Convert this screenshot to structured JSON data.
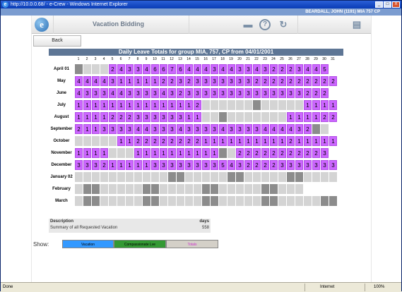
{
  "window": {
    "title": "http://10.0.0.68/ - e-Crew - Windows Internet Explorer",
    "min": "_",
    "max": "□",
    "close": "X"
  },
  "user": {
    "info": "BEARDALL, JOHN (1191) MIA 757 CP"
  },
  "header": {
    "logo_letter": "e",
    "app_title": "Vacation Bidding",
    "icons": [
      "printer-icon",
      "help-icon",
      "exit-icon",
      "notepad-icon"
    ]
  },
  "back_label": "Back",
  "grid": {
    "title": "Daily Leave Totals for group MIA, 757, CP from 04/01/2001",
    "days": [
      "1",
      "2",
      "3",
      "4",
      "5",
      "6",
      "7",
      "8",
      "9",
      "10",
      "11",
      "12",
      "13",
      "14",
      "15",
      "16",
      "17",
      "18",
      "19",
      "20",
      "21",
      "22",
      "23",
      "24",
      "25",
      "26",
      "27",
      "28",
      "29",
      "30",
      "31"
    ],
    "months": [
      {
        "name": "April 01",
        "cells": [
          "d",
          "l",
          "l",
          "l",
          "2",
          "4",
          "3",
          "3",
          "4",
          "6",
          "6",
          "7",
          "6",
          "4",
          "4",
          "4",
          "3",
          "4",
          "4",
          "3",
          "3",
          "4",
          "3",
          "2",
          "2",
          "2",
          "3",
          "4",
          "4",
          "5",
          "x"
        ]
      },
      {
        "name": "May",
        "cells": [
          "4",
          "4",
          "4",
          "4",
          "3",
          "1",
          "1",
          "1",
          "1",
          "1",
          "2",
          "2",
          "3",
          "2",
          "3",
          "3",
          "3",
          "3",
          "3",
          "3",
          "3",
          "2",
          "2",
          "2",
          "2",
          "2",
          "2",
          "2",
          "2",
          "2",
          "2"
        ]
      },
      {
        "name": "June",
        "cells": [
          "4",
          "3",
          "3",
          "3",
          "4",
          "4",
          "3",
          "3",
          "3",
          "3",
          "4",
          "3",
          "2",
          "3",
          "3",
          "3",
          "3",
          "3",
          "3",
          "3",
          "3",
          "3",
          "3",
          "3",
          "3",
          "3",
          "3",
          "2",
          "2",
          "2",
          "w"
        ]
      },
      {
        "name": "July",
        "cells": [
          "1",
          "1",
          "1",
          "1",
          "1",
          "1",
          "1",
          "1",
          "1",
          "1",
          "1",
          "1",
          "1",
          "1",
          "2",
          "l",
          "l",
          "l",
          "l",
          "l",
          "l",
          "d",
          "l",
          "l",
          "l",
          "l",
          "l",
          "1",
          "1",
          "1",
          "1"
        ]
      },
      {
        "name": "August",
        "cells": [
          "1",
          "1",
          "1",
          "1",
          "2",
          "2",
          "2",
          "3",
          "3",
          "3",
          "3",
          "3",
          "3",
          "1",
          "1",
          "l",
          "l",
          "d",
          "l",
          "l",
          "l",
          "l",
          "l",
          "l",
          "l",
          "1",
          "1",
          "1",
          "1",
          "2",
          "2"
        ]
      },
      {
        "name": "September",
        "cells": [
          "2",
          "1",
          "1",
          "3",
          "3",
          "3",
          "3",
          "4",
          "4",
          "3",
          "3",
          "3",
          "4",
          "3",
          "3",
          "3",
          "3",
          "4",
          "3",
          "3",
          "3",
          "3",
          "4",
          "4",
          "4",
          "4",
          "3",
          "2",
          "d",
          "l",
          "w"
        ]
      },
      {
        "name": "October",
        "cells": [
          "l",
          "l",
          "l",
          "l",
          "l",
          "1",
          "1",
          "2",
          "2",
          "2",
          "2",
          "2",
          "2",
          "2",
          "2",
          "1",
          "1",
          "1",
          "1",
          "1",
          "1",
          "1",
          "1",
          "1",
          "1",
          "2",
          "1",
          "1",
          "1",
          "1",
          "1"
        ]
      },
      {
        "name": "November",
        "cells": [
          "1",
          "1",
          "1",
          "1",
          "l",
          "l",
          "l",
          "1",
          "1",
          "1",
          "1",
          "1",
          "1",
          "1",
          "1",
          "1",
          "1",
          "d",
          "l",
          "2",
          "2",
          "2",
          "2",
          "2",
          "2",
          "2",
          "2",
          "2",
          "2",
          "3",
          "w"
        ]
      },
      {
        "name": "December",
        "cells": [
          "3",
          "3",
          "3",
          "2",
          "1",
          "1",
          "1",
          "1",
          "1",
          "3",
          "3",
          "3",
          "3",
          "3",
          "3",
          "3",
          "3",
          "5",
          "4",
          "3",
          "2",
          "2",
          "2",
          "2",
          "3",
          "3",
          "3",
          "3",
          "3",
          "3",
          "3"
        ]
      },
      {
        "name": "January 02",
        "cells": [
          "l",
          "l",
          "l",
          "l",
          "l",
          "l",
          "l",
          "l",
          "l",
          "l",
          "l",
          "d",
          "d",
          "l",
          "l",
          "l",
          "l",
          "l",
          "d",
          "d",
          "l",
          "l",
          "l",
          "l",
          "l",
          "d",
          "d",
          "l",
          "l",
          "l",
          "l"
        ]
      },
      {
        "name": "February",
        "cells": [
          "l",
          "d",
          "d",
          "l",
          "l",
          "l",
          "l",
          "l",
          "d",
          "d",
          "l",
          "l",
          "l",
          "l",
          "l",
          "d",
          "d",
          "l",
          "l",
          "l",
          "l",
          "l",
          "d",
          "d",
          "l",
          "l",
          "l",
          "w",
          "w",
          "w",
          "w"
        ]
      },
      {
        "name": "March",
        "cells": [
          "l",
          "d",
          "d",
          "l",
          "l",
          "l",
          "l",
          "l",
          "d",
          "d",
          "l",
          "l",
          "l",
          "l",
          "l",
          "d",
          "d",
          "l",
          "l",
          "l",
          "l",
          "l",
          "d",
          "d",
          "l",
          "l",
          "l",
          "l",
          "l",
          "d",
          "d"
        ]
      }
    ]
  },
  "summary": {
    "col_desc": "Description",
    "col_days": "days",
    "row_desc": "Summary of all Requested Vacation",
    "row_days": "558"
  },
  "legend": {
    "show_label": "Show:",
    "vacation": "Vacation",
    "compassionate": "Compassionate Lve",
    "totals": "Totals"
  },
  "statusbar": {
    "done": "Done",
    "zone": "Internet",
    "zoom": "100%"
  },
  "colors": {
    "purple": "#cc66ff",
    "light": "#d4d4d4",
    "dark": "#8c8c8c",
    "vacation": "#3399ff",
    "compassionate": "#339933",
    "totals": "#d4d0c8"
  }
}
